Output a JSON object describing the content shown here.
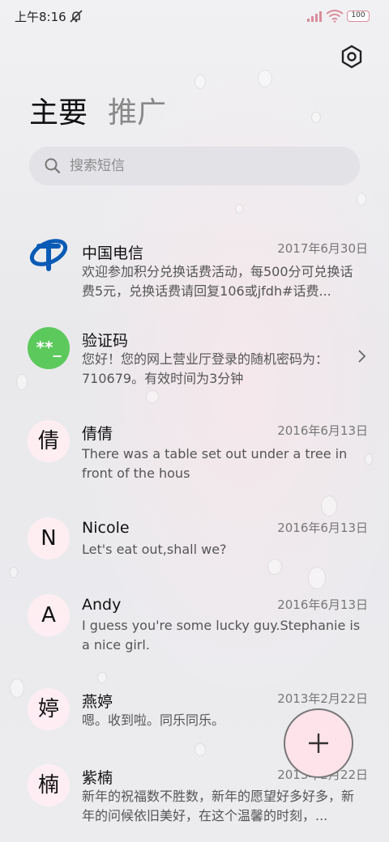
{
  "status_bar": {
    "time": "上午8:16",
    "battery": "100",
    "icons": [
      "mute-icon",
      "signal-icon",
      "wifi-icon",
      "battery-icon"
    ]
  },
  "header": {
    "settings_icon": "gear-icon",
    "tabs": [
      {
        "label": "主要",
        "active": true
      },
      {
        "label": "推广",
        "active": false
      }
    ]
  },
  "search": {
    "placeholder": "搜索短信",
    "icon": "search-icon"
  },
  "conversations": [
    {
      "avatar": "",
      "avatar_type": "china-telecom-logo-icon",
      "name": "中国电信",
      "date": "2017年6月30日",
      "preview": "欢迎参加积分兑换话费活动，每500分可兑换话费5元，兑换话费请回复106或jfdh#话费..."
    },
    {
      "avatar": "**_",
      "avatar_type": "verification-code-icon",
      "name": "验证码",
      "date": "",
      "preview": "您好！您的网上营业厅登录的随机密码为：710679。有效时间为3分钟"
    },
    {
      "avatar": "倩",
      "avatar_type": "letter",
      "name": "倩倩",
      "date": "2016年6月13日",
      "preview": "There was a table set out under a tree in front of the hous"
    },
    {
      "avatar": "N",
      "avatar_type": "letter",
      "name": "Nicole",
      "date": "2016年6月13日",
      "preview": "Let's eat out,shall we?"
    },
    {
      "avatar": "A",
      "avatar_type": "letter",
      "name": "Andy",
      "date": "2016年6月13日",
      "preview": "I guess you're some lucky guy.Stephanie is a nice girl."
    },
    {
      "avatar": "婷",
      "avatar_type": "letter",
      "name": "燕婷",
      "date": "2013年2月22日",
      "preview": "嗯。收到啦。同乐同乐。"
    },
    {
      "avatar": "楠",
      "avatar_type": "letter",
      "name": "紫楠",
      "date": "2013年2月22日",
      "preview": "新年的祝福数不胜数，新年的愿望好多好多，新年的问候依旧美好，在这个温馨的时刻，..."
    }
  ],
  "fab": {
    "icon": "plus-icon",
    "color": "#ffe3ea"
  },
  "colors": {
    "green_avatar": "#5cc95c",
    "telecom_blue": "#0a5bb5"
  }
}
